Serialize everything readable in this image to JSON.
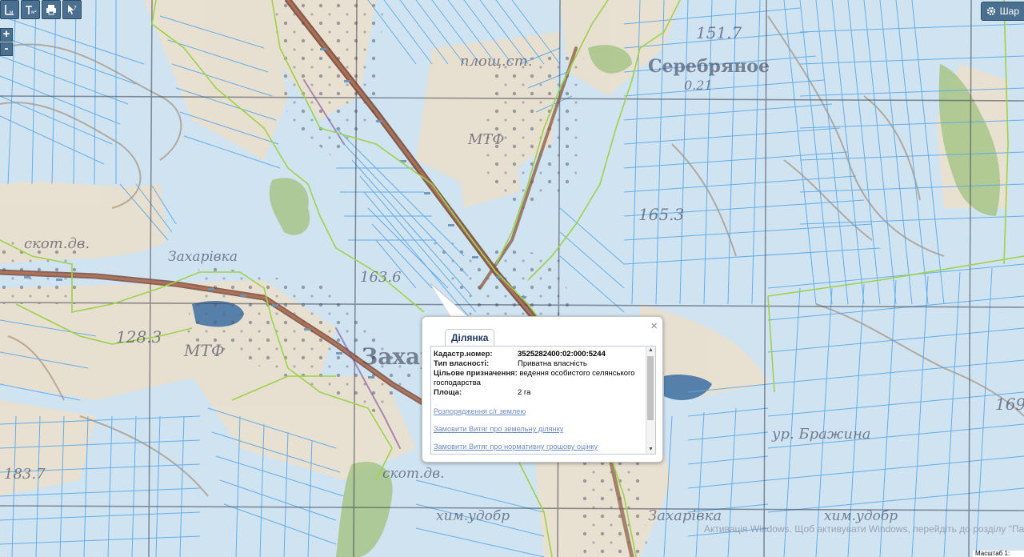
{
  "map": {
    "labels": {
      "serebryanoe": "Серебряное",
      "elev_151": "151.7",
      "elev_021": "0.21",
      "elev_165": "165.3",
      "elev_163": "163.6",
      "elev_128": "128.3",
      "elev_183": "183.7",
      "mtf1": "МТФ",
      "mtf2": "МТФ",
      "plosht": "площ.ст.",
      "skotdv": "скот.дв.",
      "zahar1": "Захарівка",
      "zahar2": "Захарівка",
      "zahar_big": "Захар",
      "brazhina": "ур. Бражина",
      "khimudobr": "хим.удобр",
      "khimudobr2": "хим.удобр",
      "mtf_label": "МТФ",
      "skot2": "скот.дв.",
      "right_169": "169"
    }
  },
  "toolbar": {
    "measure_length": "length-measure-icon",
    "measure_area": "area-measure-icon",
    "print": "printer-icon",
    "identify": "identify-cursor-icon"
  },
  "zoom": {
    "in": "+",
    "out": "-"
  },
  "layers_button": {
    "label": "Шар"
  },
  "popup": {
    "tab": "Ділянка",
    "close": "×",
    "fields": [
      {
        "key": "Кадастр.номер:",
        "value": "3525282400:02:000:5244"
      },
      {
        "key": "Тип власності:",
        "value": "Приватна власність"
      },
      {
        "key": "Цільове призначення:",
        "value": "ведення особистого селянського господарства"
      },
      {
        "key": "Площа:",
        "value": "2 га"
      }
    ],
    "links": [
      "Розпорядження с/г землею",
      "Замовити Витяг про земельну ділянку",
      "Замовити Витяг про нормативну грошову оцінку"
    ]
  },
  "watermark": "Активація Windows. Щоб активувати Windows, перейдіть до розділу \"Параметри\".",
  "scale": "Масштаб 1:"
}
